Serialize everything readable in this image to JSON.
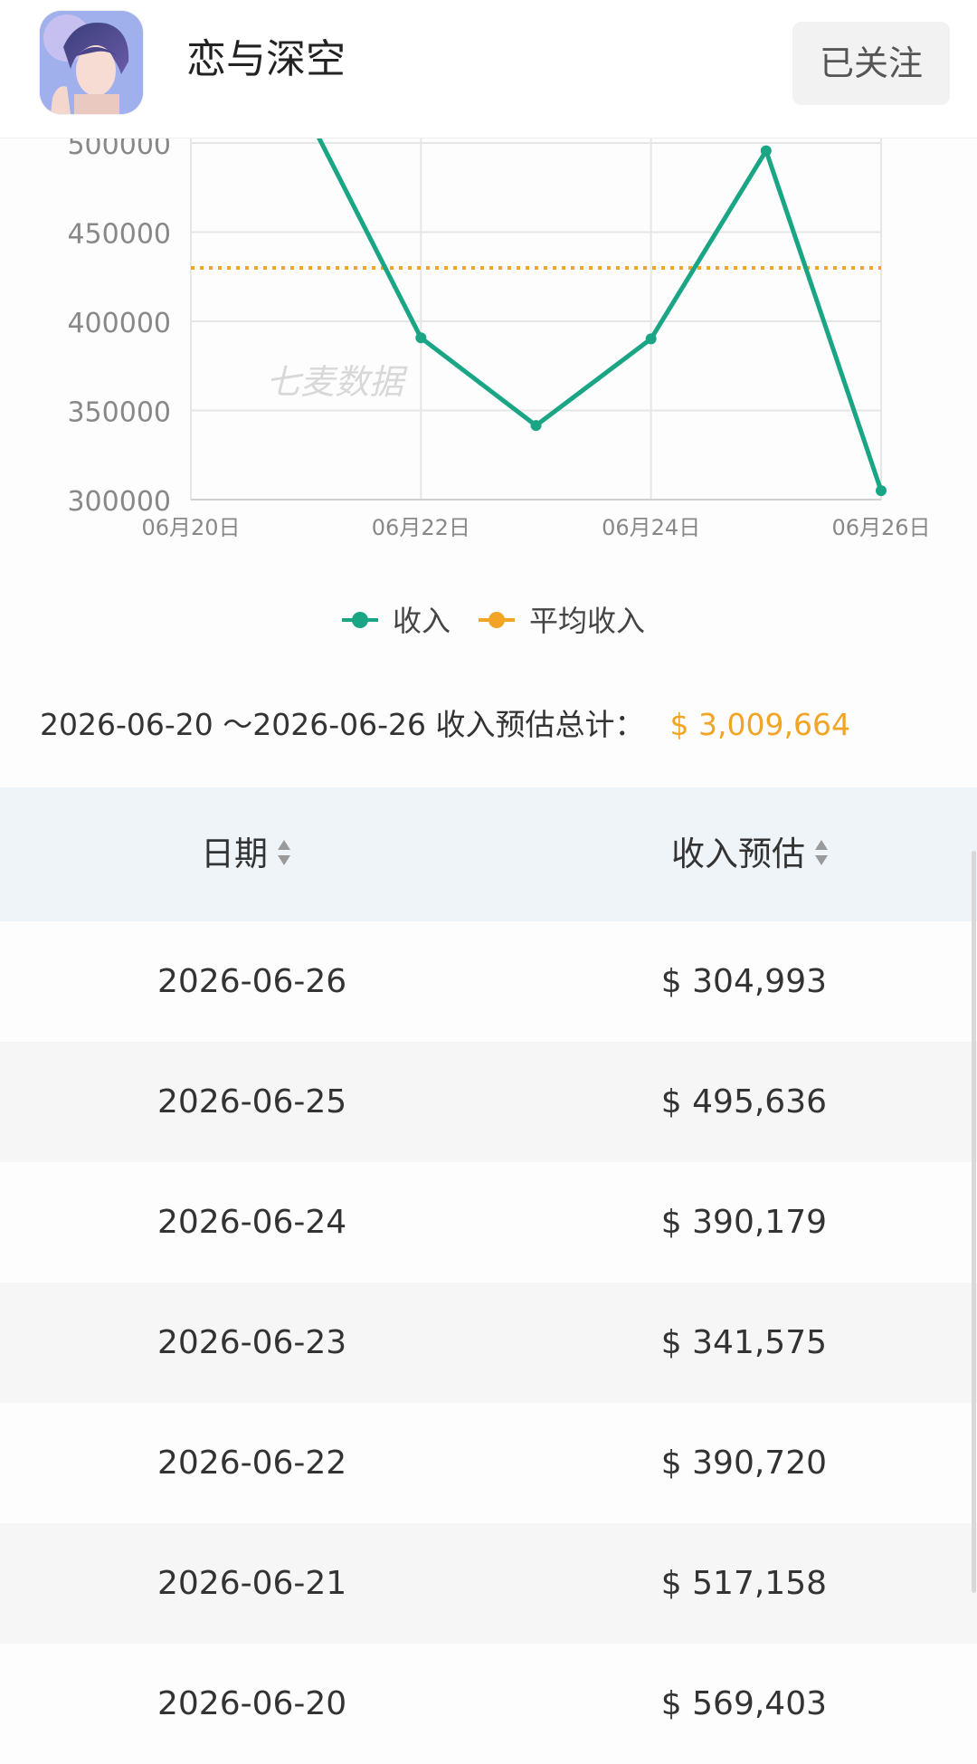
{
  "header": {
    "app_name": "恋与深空",
    "follow_label": "已关注"
  },
  "chart_data": {
    "type": "line",
    "x": [
      "06月20日",
      "06月21日",
      "06月22日",
      "06月23日",
      "06月24日",
      "06月25日",
      "06月26日"
    ],
    "x_tick_labels": [
      "06月20日",
      "06月22日",
      "06月24日",
      "06月26日"
    ],
    "ylim": [
      300000,
      500000
    ],
    "y_ticks": [
      "300000",
      "350000",
      "400000",
      "450000",
      "500000"
    ],
    "series": [
      {
        "name": "收入",
        "color": "#1aa585",
        "values": [
          569403,
          517158,
          390720,
          341575,
          390179,
          495636,
          304993
        ]
      },
      {
        "name": "平均收入",
        "color": "#f2a425",
        "style": "dotted",
        "values": [
          429952,
          429952,
          429952,
          429952,
          429952,
          429952,
          429952
        ]
      }
    ],
    "grid": true,
    "legend": "bottom-center",
    "watermark": "七麦数据"
  },
  "summary": {
    "range_label": "2026-06-20 ～2026-06-26 收入预估总计：",
    "total": "$ 3,009,664"
  },
  "table": {
    "columns": [
      "日期",
      "收入预估"
    ],
    "rows": [
      {
        "date": "2026-06-26",
        "revenue": "$ 304,993"
      },
      {
        "date": "2026-06-25",
        "revenue": "$ 495,636"
      },
      {
        "date": "2026-06-24",
        "revenue": "$ 390,179"
      },
      {
        "date": "2026-06-23",
        "revenue": "$ 341,575"
      },
      {
        "date": "2026-06-22",
        "revenue": "$ 390,720"
      },
      {
        "date": "2026-06-21",
        "revenue": "$ 517,158"
      },
      {
        "date": "2026-06-20",
        "revenue": "$ 569,403"
      }
    ]
  },
  "icons": {
    "sort": "sort-icon",
    "app": "app-icon"
  }
}
